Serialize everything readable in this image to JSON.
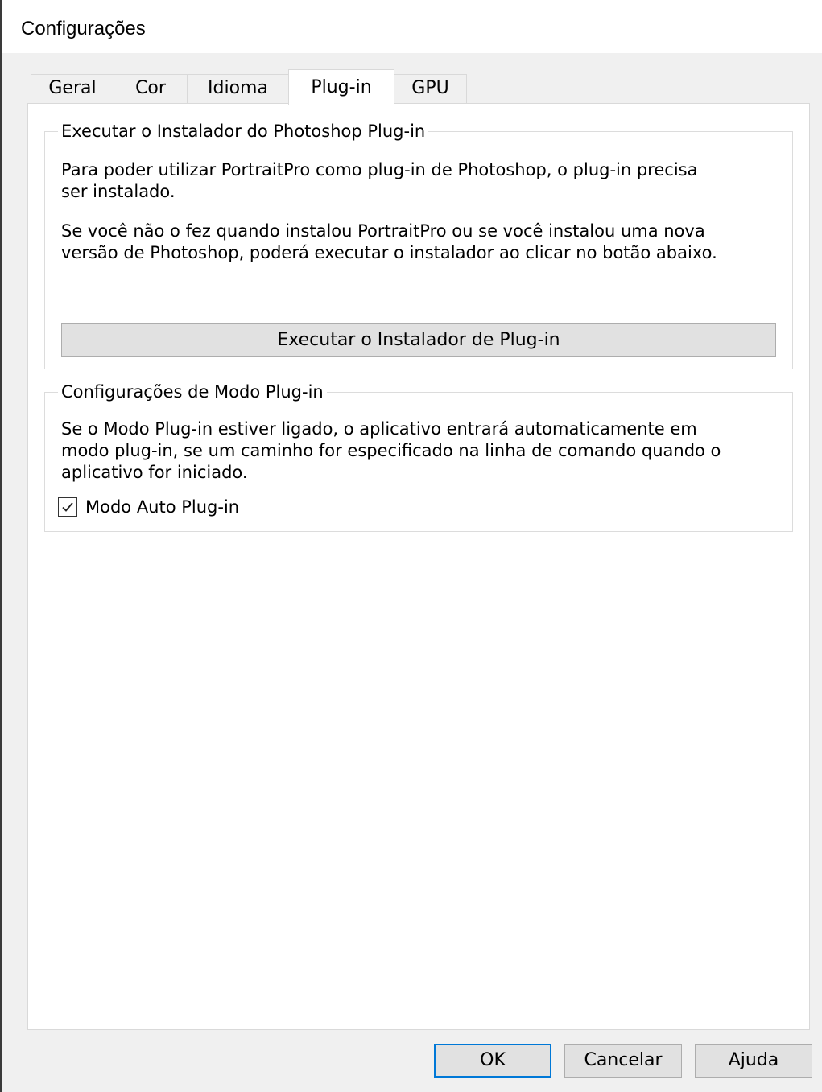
{
  "window": {
    "title": "Configurações"
  },
  "tabs": [
    {
      "label": "Geral",
      "active": false
    },
    {
      "label": "Cor",
      "active": false
    },
    {
      "label": "Idioma",
      "active": false
    },
    {
      "label": "Plug-in",
      "active": true
    },
    {
      "label": "GPU",
      "active": false
    }
  ],
  "installer_group": {
    "legend": "Executar o Instalador do Photoshop Plug-in",
    "paragraph1_line1": "Para poder utilizar PortraitPro como plug-in de Photoshop, o plug-in precisa",
    "paragraph1_line2": "ser instalado.",
    "paragraph2_line1": "Se você não o fez quando instalou PortraitPro ou se você instalou uma nova",
    "paragraph2_line2": "versão de Photoshop, poderá executar o instalador ao clicar no botão abaixo.",
    "button_label": "Executar o Instalador de Plug-in"
  },
  "mode_group": {
    "legend": "Configurações de Modo Plug-in",
    "description_line1": "Se o Modo Plug-in estiver ligado, o aplicativo entrará automaticamente em",
    "description_line2": "modo plug-in, se um caminho for especificado na linha de comando quando o",
    "description_line3": "aplicativo for iniciado.",
    "checkbox_label": "Modo Auto Plug-in",
    "checkbox_checked": true
  },
  "footer": {
    "ok_label": "OK",
    "cancel_label": "Cancelar",
    "help_label": "Ajuda"
  },
  "colors": {
    "dialog_background": "#f0f0f0",
    "panel_background": "#ffffff",
    "button_face": "#e1e1e1",
    "default_button_border": "#0078d7"
  }
}
